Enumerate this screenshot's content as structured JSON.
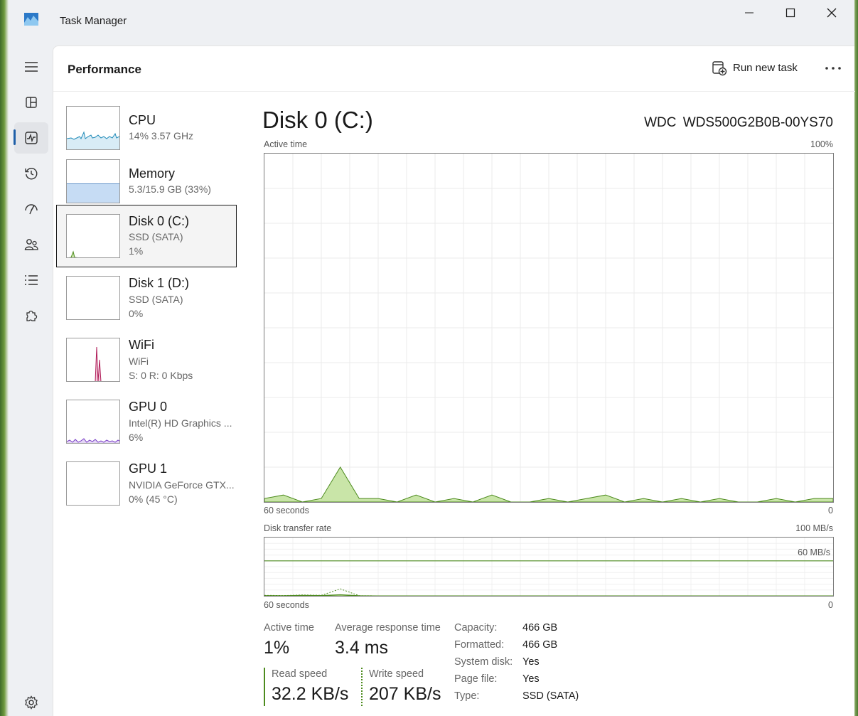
{
  "window": {
    "title": "Task Manager"
  },
  "nav": {
    "active": "performance",
    "items": [
      "menu",
      "processes",
      "performance",
      "app-history",
      "startup-apps",
      "users",
      "details",
      "services",
      "settings"
    ]
  },
  "header": {
    "page_title": "Performance",
    "run_new_task": "Run new task"
  },
  "resources": [
    {
      "name": "CPU",
      "sub1": "14%  3.57 GHz",
      "sub2": ""
    },
    {
      "name": "Memory",
      "sub1": "5.3/15.9 GB (33%)",
      "sub2": ""
    },
    {
      "name": "Disk 0 (C:)",
      "sub1": "SSD (SATA)",
      "sub2": "1%"
    },
    {
      "name": "Disk 1 (D:)",
      "sub1": "SSD (SATA)",
      "sub2": "0%"
    },
    {
      "name": "WiFi",
      "sub1": "WiFi",
      "sub2": "S: 0  R: 0 Kbps"
    },
    {
      "name": "GPU 0",
      "sub1": "Intel(R) HD Graphics ...",
      "sub2": "6%"
    },
    {
      "name": "GPU 1",
      "sub1": "NVIDIA GeForce GTX...",
      "sub2": "0%  (45 °C)"
    }
  ],
  "detail": {
    "title": "Disk 0 (C:)",
    "model": "WDC  WDS500G2B0B-00YS70",
    "active_time_graph": {
      "label": "Active time",
      "max_label": "100%",
      "x_left": "60 seconds",
      "x_right": "0"
    },
    "transfer_graph": {
      "label": "Disk transfer rate",
      "max_label": "100 MB/s",
      "line_label": "60 MB/s",
      "x_left": "60 seconds",
      "x_right": "0"
    },
    "stats": {
      "active_time_label": "Active time",
      "active_time_value": "1%",
      "avg_response_label": "Average response time",
      "avg_response_value": "3.4 ms",
      "read_label": "Read speed",
      "read_value": "32.2 KB/s",
      "write_label": "Write speed",
      "write_value": "207 KB/s"
    },
    "properties": [
      {
        "label": "Capacity:",
        "value": "466 GB"
      },
      {
        "label": "Formatted:",
        "value": "466 GB"
      },
      {
        "label": "System disk:",
        "value": "Yes"
      },
      {
        "label": "Page file:",
        "value": "Yes"
      },
      {
        "label": "Type:",
        "value": "SSD (SATA)"
      }
    ]
  },
  "chart_data": [
    {
      "type": "area",
      "title": "Active time",
      "ylim": [
        0,
        100
      ],
      "x": [
        60,
        58,
        56,
        54,
        52,
        50,
        48,
        46,
        44,
        42,
        40,
        38,
        36,
        34,
        32,
        30,
        28,
        26,
        24,
        22,
        20,
        18,
        16,
        14,
        12,
        10,
        8,
        6,
        4,
        2,
        0
      ],
      "series": [
        {
          "values": [
            1,
            2,
            0,
            1,
            10,
            1,
            1,
            0,
            2,
            0,
            1,
            0,
            2,
            0,
            0,
            1,
            0,
            1,
            2,
            0,
            1,
            0,
            1,
            0,
            1,
            0,
            0,
            1,
            0,
            1,
            1
          ]
        }
      ]
    },
    {
      "type": "line",
      "title": "Disk transfer rate",
      "ylim": [
        0,
        100
      ],
      "reference_line": 60,
      "x": [
        60,
        58,
        56,
        54,
        52,
        50,
        48,
        46,
        44,
        42,
        40,
        38,
        36,
        34,
        32,
        30,
        28,
        26,
        24,
        22,
        20,
        18,
        16,
        14,
        12,
        10,
        8,
        6,
        4,
        2,
        0
      ],
      "series": [
        {
          "name": "Read speed",
          "values": [
            0.5,
            0.3,
            1,
            0.6,
            2,
            0.2,
            0,
            0,
            0,
            0,
            0,
            0,
            0,
            0,
            0,
            0,
            0,
            0,
            0,
            0,
            0,
            0,
            0,
            0,
            0,
            0,
            0,
            0,
            0,
            0,
            0
          ]
        },
        {
          "name": "Write speed",
          "values": [
            0.8,
            0.5,
            1.5,
            0.9,
            12,
            0.3,
            0,
            0,
            0,
            0,
            0,
            0,
            0,
            0,
            0,
            0,
            0,
            0,
            0,
            0,
            0,
            0,
            0,
            0,
            0,
            0,
            0,
            0,
            0,
            0,
            0
          ]
        }
      ]
    }
  ],
  "colors": {
    "disk_line": "#4d8b1e",
    "disk_fill": "#c9e5a8",
    "cpu_line": "#1f8ab8",
    "memory_fill": "#c6dcf4",
    "wifi_line": "#b01e5a",
    "gpu_line": "#7a3fc6",
    "nav_accent": "#1f5fa8"
  }
}
